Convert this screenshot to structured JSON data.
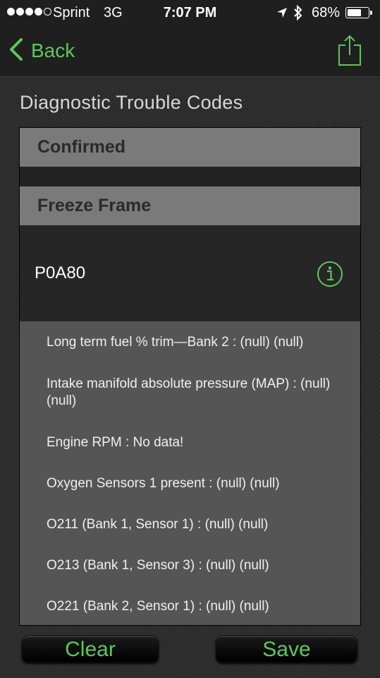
{
  "status_bar": {
    "carrier": "Sprint",
    "network": "3G",
    "time": "7:07 PM",
    "battery_percent": "68%",
    "battery_level": 0.68,
    "signal_bars": 4
  },
  "nav": {
    "back_label": "Back"
  },
  "page_title": "Diagnostic Trouble Codes",
  "sections": {
    "confirmed": "Confirmed",
    "freeze_frame": "Freeze Frame"
  },
  "code": {
    "label": "P0A80"
  },
  "details": [
    "Long term fuel % trim—Bank 2 : (null) (null)",
    "Intake manifold absolute pressure (MAP) : (null) (null)",
    "Engine RPM : No data!",
    "Oxygen Sensors 1 present : (null) (null)",
    "O211 (Bank 1, Sensor 1) : (null) (null)",
    "O213 (Bank 1, Sensor 3) : (null) (null)",
    "O221 (Bank 2, Sensor 1) : (null) (null)"
  ],
  "buttons": {
    "clear": "Clear",
    "save": "Save"
  },
  "colors": {
    "accent": "#5cc85a",
    "header_bg": "#7a7a7a",
    "panel_bg": "#555555"
  },
  "icons": {
    "back": "chevron-left-icon",
    "share": "share-icon",
    "info": "info-icon",
    "location": "location-arrow-icon",
    "bluetooth": "bluetooth-icon",
    "battery": "battery-icon"
  }
}
